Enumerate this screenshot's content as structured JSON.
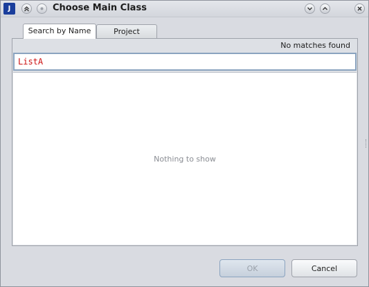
{
  "window": {
    "title": "Choose Main Class",
    "app_icon_text": "J"
  },
  "titlebar_buttons": {
    "left": [
      "roll-up-icon",
      "sticky-icon"
    ],
    "right": [
      "minimize-icon",
      "maximize-icon",
      "close-icon"
    ]
  },
  "tabs": [
    {
      "label": "Search by Name",
      "active": true
    },
    {
      "label": "Project",
      "active": false
    }
  ],
  "search": {
    "status": "No matches found",
    "value": "ListA",
    "value_color": "#cc1111"
  },
  "results": {
    "empty_message": "Nothing to show"
  },
  "buttons": {
    "ok_label": "OK",
    "ok_enabled": false,
    "cancel_label": "Cancel"
  }
}
